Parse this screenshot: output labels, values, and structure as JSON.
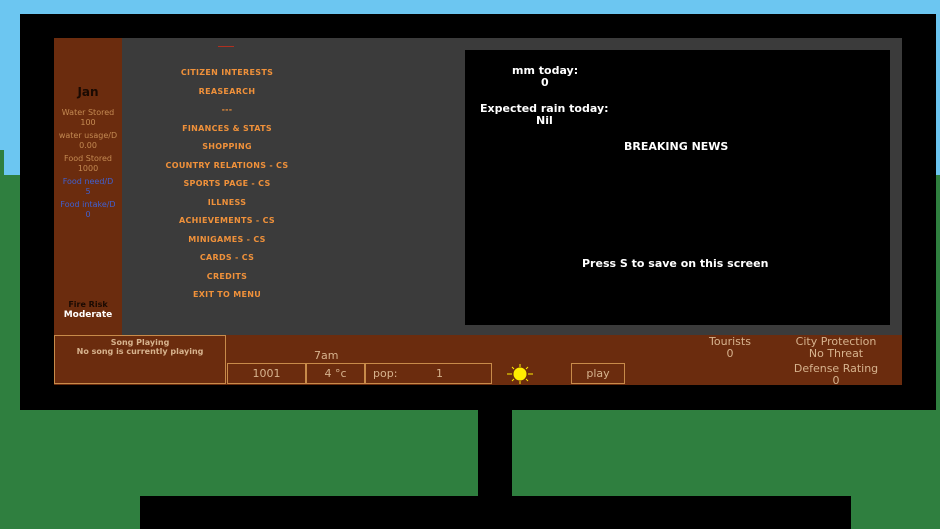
{
  "stats": {
    "month": "Jan",
    "water_stored_label": "Water Stored",
    "water_stored_value": "100",
    "water_usage_label": "water usage/D",
    "water_usage_value": "0.00",
    "food_stored_label": "Food Stored",
    "food_stored_value": "1000",
    "food_need_label": "Food need/D",
    "food_need_value": "5",
    "food_intake_label": "Food intake/D",
    "food_intake_value": "0",
    "fire_risk_label": "Fire Risk",
    "fire_risk_value": "Moderate"
  },
  "menu": {
    "items": [
      "CITIZEN INTERESTS",
      "REASEARCH",
      "---",
      "FINANCES & STATS",
      "SHOPPING",
      "COUNTRY RELATIONS - CS",
      "SPORTS PAGE - CS",
      "ILLNESS",
      "ACHIEVEMENTS - CS",
      "MINIGAMES - CS",
      "CARDS - CS",
      "CREDITS",
      "EXIT TO MENU"
    ]
  },
  "news": {
    "mm_label": "mm today:",
    "mm_value": "0",
    "rain_label": "Expected rain today:",
    "rain_value": "Nil",
    "breaking": "BREAKING NEWS",
    "save_hint": "Press S to save on this screen"
  },
  "bottom": {
    "song_heading": "Song Playing",
    "song_status": "No song is currently playing",
    "time": "7am",
    "money": "1001",
    "temperature": "4 °c",
    "pop_label": "pop:",
    "pop_value": "1",
    "weather_icon": "sun-icon",
    "play_label": "play",
    "tourists_label": "Tourists",
    "tourists_value": "0",
    "city_protection_label": "City Protection",
    "city_protection_value": "No Threat",
    "defense_label": "Defense Rating",
    "defense_value": "0"
  },
  "colors": {
    "panel": "#6b2c0e",
    "menu_text": "#f0913a",
    "screen_bg": "#3b3b3b",
    "sky": "#6cc6f1",
    "grass": "#2f7f3f",
    "sun": "#ffee00"
  }
}
